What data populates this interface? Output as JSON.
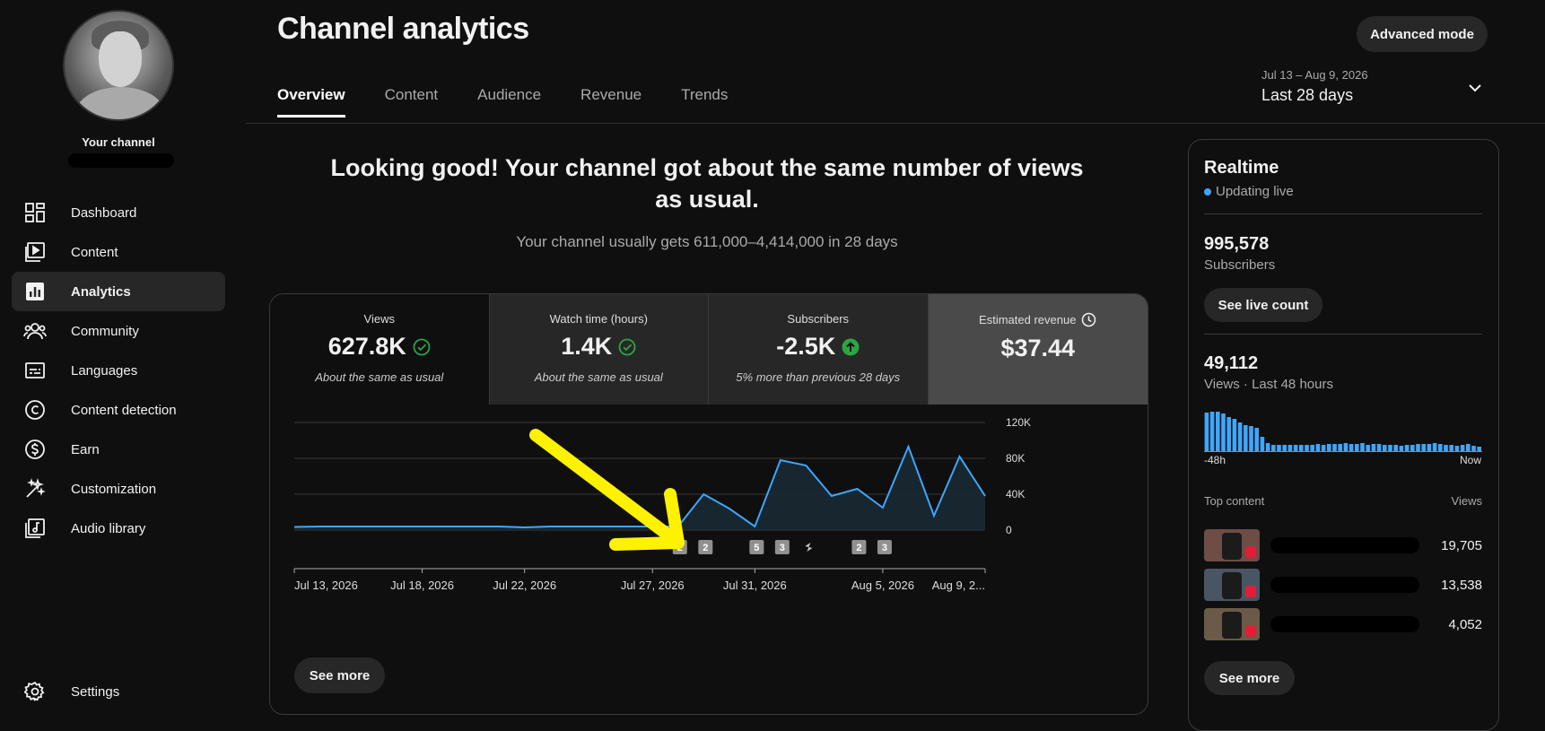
{
  "sidebar": {
    "channel_label": "Your channel",
    "items": [
      {
        "label": "Dashboard",
        "icon": "dashboard-icon"
      },
      {
        "label": "Content",
        "icon": "content-icon"
      },
      {
        "label": "Analytics",
        "icon": "analytics-icon",
        "active": true
      },
      {
        "label": "Community",
        "icon": "community-icon"
      },
      {
        "label": "Languages",
        "icon": "languages-icon"
      },
      {
        "label": "Content detection",
        "icon": "copyright-icon"
      },
      {
        "label": "Earn",
        "icon": "earn-icon"
      },
      {
        "label": "Customization",
        "icon": "customization-icon"
      },
      {
        "label": "Audio library",
        "icon": "audio-library-icon"
      }
    ],
    "settings_label": "Settings"
  },
  "header": {
    "title": "Channel analytics",
    "advanced_mode": "Advanced mode",
    "tabs": [
      "Overview",
      "Content",
      "Audience",
      "Revenue",
      "Trends"
    ],
    "date_range_dates": "Jul 13 – Aug 9, 2026",
    "date_range_label": "Last 28 days"
  },
  "overview": {
    "headline": "Looking good! Your channel got about the same number of views as usual.",
    "subline": "Your channel usually gets 611,000–4,414,000 in 28 days",
    "metrics": [
      {
        "label": "Views",
        "value": "627.8K",
        "note": "About the same as usual",
        "status": "check"
      },
      {
        "label": "Watch time (hours)",
        "value": "1.4K",
        "note": "About the same as usual",
        "status": "check"
      },
      {
        "label": "Subscribers",
        "value": "-2.5K",
        "note": "5% more than previous 28 days",
        "status": "up"
      },
      {
        "label": "Estimated revenue",
        "value": "$37.44",
        "note": "",
        "status": "clock"
      }
    ],
    "see_more": "See more"
  },
  "chart_data": {
    "type": "area",
    "x": [
      "Jul 13, 2026",
      "Jul 14",
      "Jul 15",
      "Jul 16",
      "Jul 17",
      "Jul 18, 2026",
      "Jul 19",
      "Jul 20",
      "Jul 21",
      "Jul 22, 2026",
      "Jul 23",
      "Jul 24",
      "Jul 25",
      "Jul 26",
      "Jul 27, 2026",
      "Jul 28",
      "Jul 29",
      "Jul 30",
      "Jul 31, 2026",
      "Aug 1",
      "Aug 2",
      "Aug 3",
      "Aug 4",
      "Aug 5, 2026",
      "Aug 6",
      "Aug 7",
      "Aug 8",
      "Aug 9"
    ],
    "values": [
      3500,
      4000,
      4000,
      4000,
      4000,
      4000,
      4000,
      4000,
      4000,
      3000,
      4000,
      4000,
      4000,
      4000,
      4000,
      4000,
      40000,
      24000,
      4000,
      78000,
      72000,
      38000,
      46000,
      25000,
      93000,
      16000,
      82000,
      38000
    ],
    "y_ticks": [
      "120K",
      "80K",
      "40K",
      "0"
    ],
    "ylim": [
      0,
      120000
    ],
    "x_tick_labels": [
      "Jul 13, 2026",
      "Jul 18, 2026",
      "Jul 22, 2026",
      "Jul 27, 2026",
      "Jul 31, 2026",
      "Aug 5, 2026",
      "Aug 9, 2..."
    ],
    "markers": [
      "2",
      "2",
      "5",
      "3",
      "shorts",
      "2",
      "3"
    ],
    "series_color": "#3ea6ff",
    "grid": true
  },
  "realtime": {
    "title": "Realtime",
    "status": "Updating live",
    "subscribers_value": "995,578",
    "subscribers_label": "Subscribers",
    "see_live_count": "See live count",
    "views_value": "49,112",
    "views_label": "Views · Last 48 hours",
    "bars": [
      88,
      90,
      90,
      86,
      78,
      74,
      66,
      60,
      58,
      54,
      34,
      20,
      16,
      16,
      16,
      16,
      16,
      16,
      16,
      16,
      18,
      16,
      18,
      18,
      18,
      20,
      18,
      18,
      20,
      16,
      18,
      18,
      16,
      16,
      16,
      14,
      16,
      16,
      18,
      18,
      18,
      20,
      18,
      16,
      16,
      14,
      16,
      18,
      14,
      12
    ],
    "axis_start": "-48h",
    "axis_end": "Now",
    "top_content_label": "Top content",
    "views_col_label": "Views",
    "top_content": [
      {
        "views": "19,705"
      },
      {
        "views": "13,538"
      },
      {
        "views": "4,052"
      }
    ],
    "see_more": "See more"
  }
}
